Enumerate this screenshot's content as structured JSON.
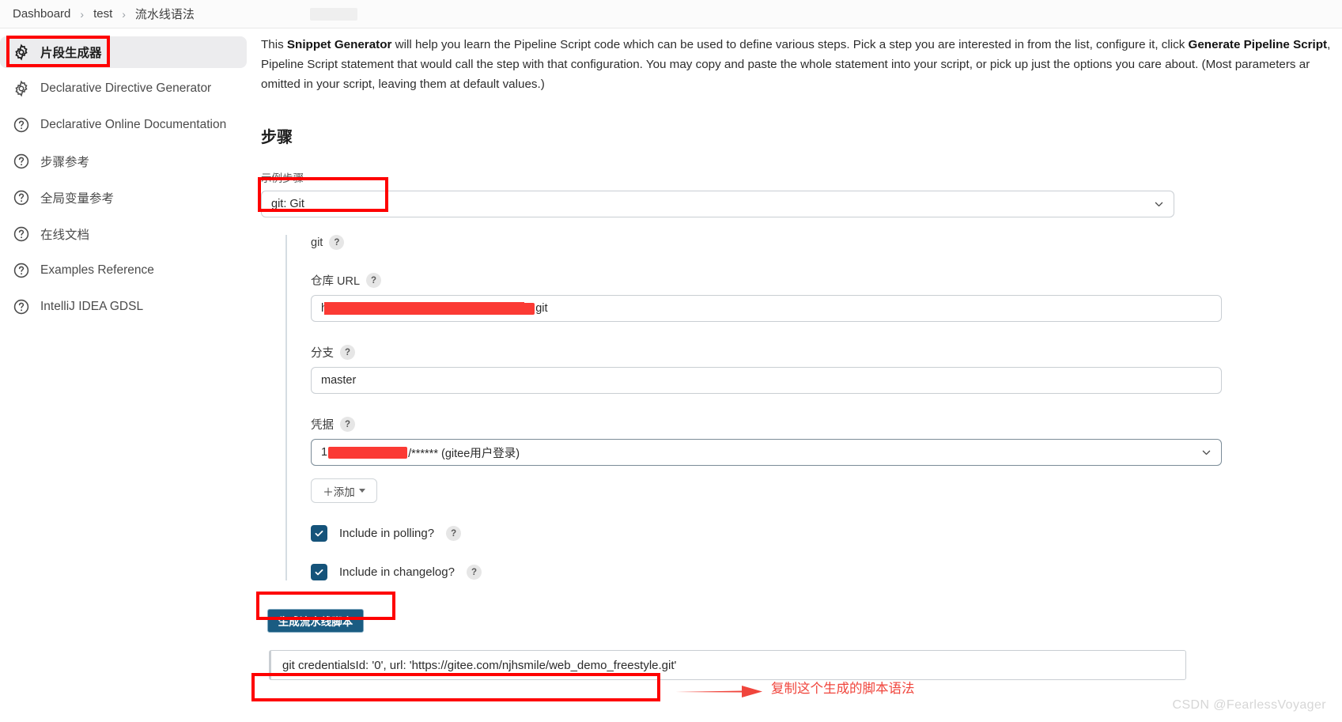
{
  "breadcrumb": {
    "items": [
      "Dashboard",
      "test",
      "流水线语法"
    ],
    "separator": "›"
  },
  "sidebar": {
    "items": [
      {
        "label": "片段生成器",
        "icon": "gear-icon",
        "active": true
      },
      {
        "label": "Declarative Directive Generator",
        "icon": "gear-icon",
        "active": false
      },
      {
        "label": "Declarative Online Documentation",
        "icon": "help-circle-icon",
        "active": false
      },
      {
        "label": "步骤参考",
        "icon": "help-circle-icon",
        "active": false
      },
      {
        "label": "全局变量参考",
        "icon": "help-circle-icon",
        "active": false
      },
      {
        "label": "在线文档",
        "icon": "help-circle-icon",
        "active": false
      },
      {
        "label": "Examples Reference",
        "icon": "help-circle-icon",
        "active": false
      },
      {
        "label": "IntelliJ IDEA GDSL",
        "icon": "help-circle-icon",
        "active": false
      }
    ]
  },
  "intro": {
    "line1_a": "This ",
    "line1_b": "Snippet Generator",
    "line1_c": " will help you learn the Pipeline Script code which can be used to define various steps. Pick a step you are interested in from the list, configure it, click ",
    "line1_d": "Generate Pipeline Script",
    "line1_e": ",",
    "line2": "Pipeline Script statement that would call the step with that configuration. You may copy and paste the whole statement into your script, or pick up just the options you care about. (Most parameters ar",
    "line3": "omitted in your script, leaving them at default values.)"
  },
  "main": {
    "section_title": "步骤",
    "sample_step_label": "示例步骤",
    "sample_step_value": "git: Git",
    "git_block_label": "git",
    "help_glyph": "?",
    "repo_url_label": "仓库 URL",
    "repo_url_prefix": "http",
    "repo_url_suffix": "git",
    "branch_label": "分支",
    "branch_value": "master",
    "credentials_label": "凭据",
    "credentials_prefix": "1",
    "credentials_suffix": "/****** (gitee用户登录)",
    "add_button_label": "＋添加",
    "checkbox_polling_label": "Include in polling?",
    "checkbox_changelog_label": "Include in changelog?",
    "generate_button_label": "生成流水线脚本",
    "generated_script": "git credentialsId: '0', url: 'https://gitee.com/njhsmile/web_demo_freestyle.git'"
  },
  "annotations": {
    "copy_hint": "复制这个生成的脚本语法",
    "watermark": "CSDN @FearlessVoyager",
    "highlight_color": "#fe0000",
    "annotation_color": "#f0453c"
  }
}
